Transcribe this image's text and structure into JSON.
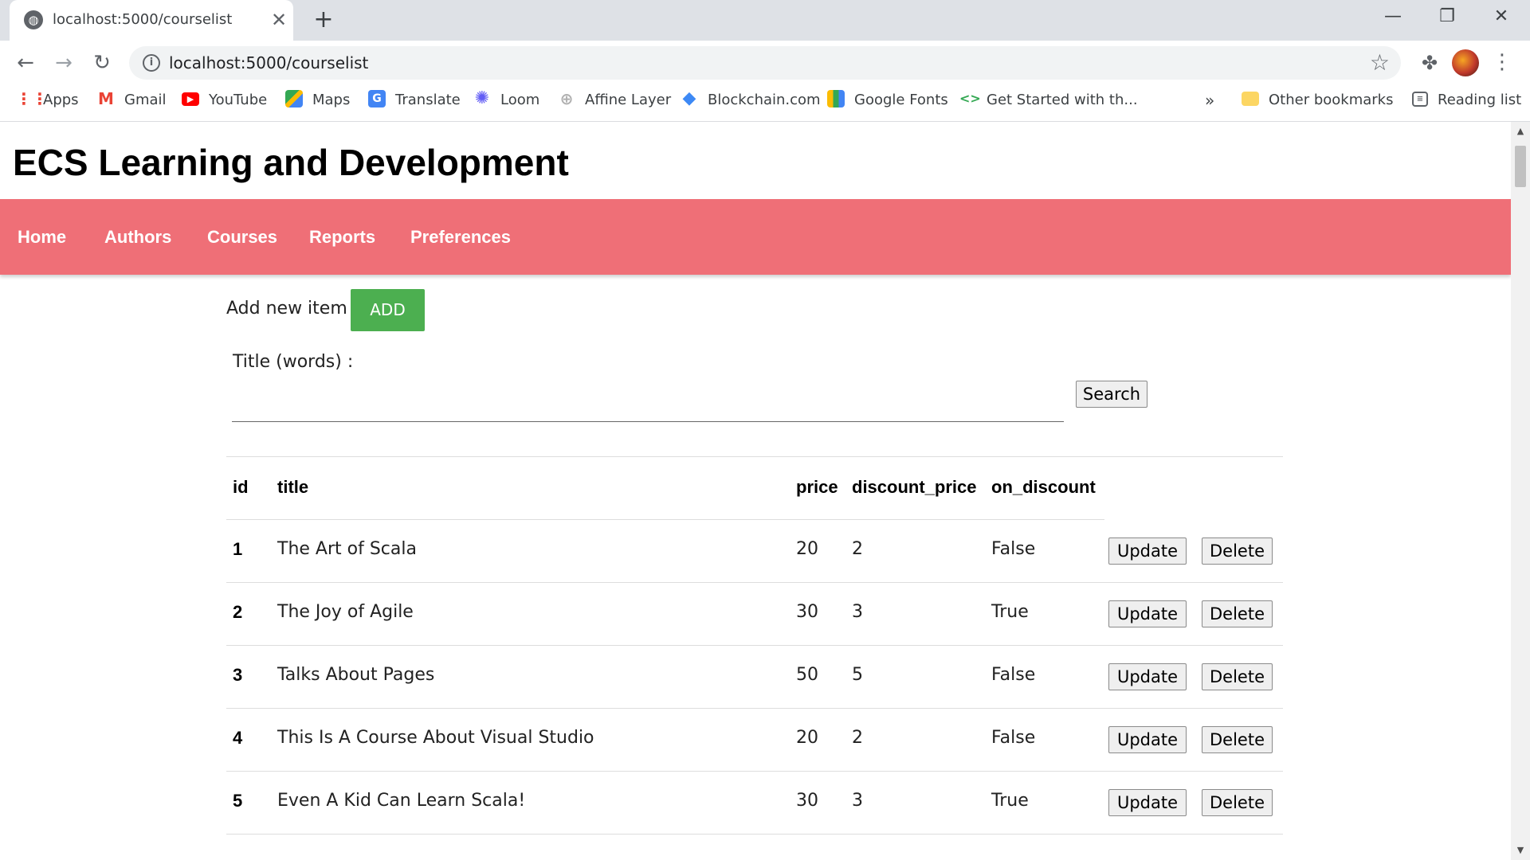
{
  "browser": {
    "tab_title": "localhost:5000/courselist",
    "url": "localhost:5000/courselist",
    "bookmarks": [
      {
        "label": "Apps",
        "icon": "apps-grid-icon"
      },
      {
        "label": "Gmail",
        "icon": "gmail-icon"
      },
      {
        "label": "YouTube",
        "icon": "youtube-icon"
      },
      {
        "label": "Maps",
        "icon": "maps-icon"
      },
      {
        "label": "Translate",
        "icon": "translate-icon"
      },
      {
        "label": "Loom",
        "icon": "loom-icon"
      },
      {
        "label": "Affine Layer",
        "icon": "affine-layer-icon"
      },
      {
        "label": "Blockchain.com",
        "icon": "blockchain-icon"
      },
      {
        "label": "Google Fonts",
        "icon": "google-fonts-icon"
      },
      {
        "label": "Get Started with th...",
        "icon": "code-icon"
      }
    ],
    "overflow": "»",
    "other_bookmarks": "Other bookmarks",
    "reading_list": "Reading list"
  },
  "page": {
    "site_title": "ECS Learning and Development",
    "nav": [
      "Home",
      "Authors",
      "Courses",
      "Reports",
      "Preferences"
    ],
    "add_label": "Add new item :",
    "add_button": "ADD",
    "title_label": "Title (words) :",
    "title_value": "",
    "search_button": "Search",
    "columns": [
      "id",
      "title",
      "price",
      "discount_price",
      "on_discount"
    ],
    "update_label": "Update",
    "delete_label": "Delete",
    "rows": [
      {
        "id": "1",
        "title": "The Art of Scala",
        "price": "20",
        "discount_price": "2",
        "on_discount": "False"
      },
      {
        "id": "2",
        "title": "The Joy of Agile",
        "price": "30",
        "discount_price": "3",
        "on_discount": "True"
      },
      {
        "id": "3",
        "title": "Talks About Pages",
        "price": "50",
        "discount_price": "5",
        "on_discount": "False"
      },
      {
        "id": "4",
        "title": "This Is A Course About Visual Studio",
        "price": "20",
        "discount_price": "2",
        "on_discount": "False"
      },
      {
        "id": "5",
        "title": "Even A Kid Can Learn Scala!",
        "price": "30",
        "discount_price": "3",
        "on_discount": "True"
      }
    ]
  },
  "colors": {
    "navbar": "#ef6f77",
    "add_button": "#4caf50",
    "tab_strip": "#dee1e6"
  }
}
